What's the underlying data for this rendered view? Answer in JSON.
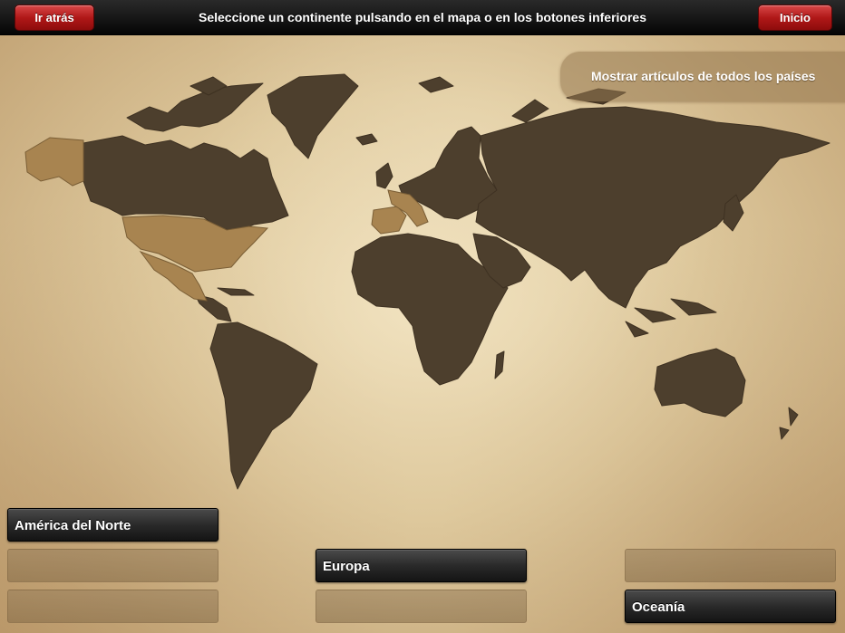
{
  "header": {
    "back_label": "Ir atrás",
    "title": "Seleccione un continente pulsando en el mapa o en los botones inferiores",
    "home_label": "Inicio"
  },
  "show_all_label": "Mostrar artículos de todos los países",
  "continent_buttons": {
    "col1": [
      "América del Norte",
      "",
      ""
    ],
    "col2": [
      "Europa",
      ""
    ],
    "col3": [
      "",
      "Oceanía"
    ]
  },
  "colors": {
    "accent_red": "#b01818",
    "land_dark": "#4a3c2a",
    "land_highlight": "#a07a45"
  }
}
